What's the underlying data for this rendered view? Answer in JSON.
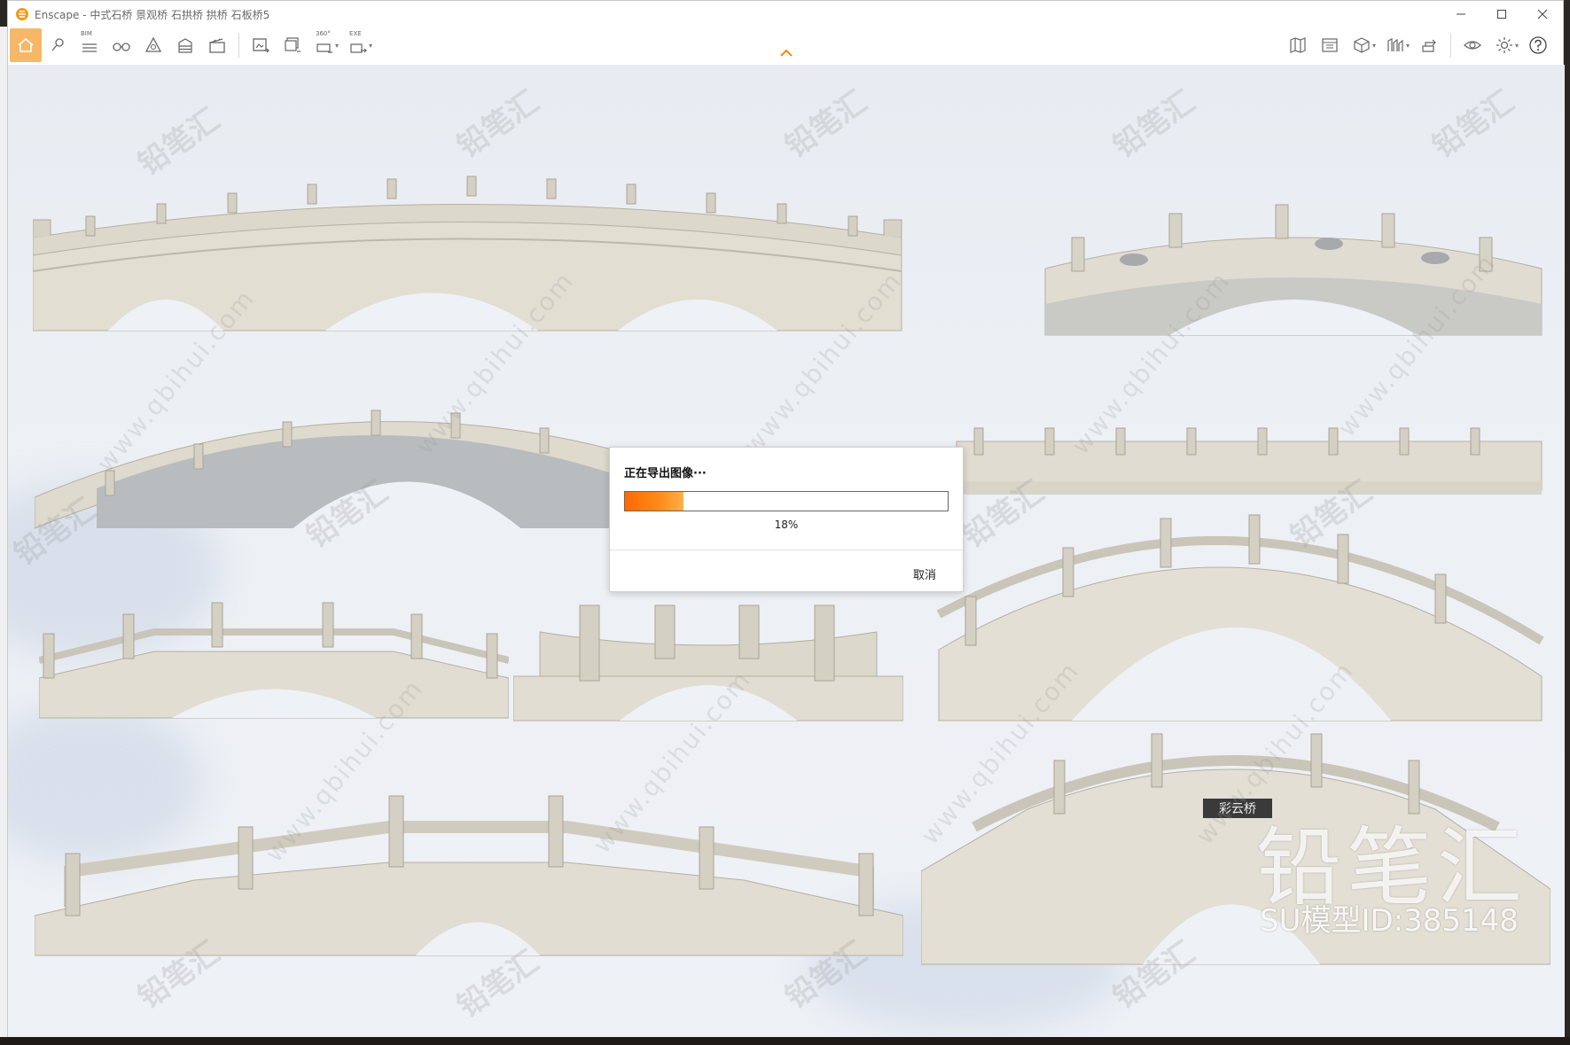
{
  "window": {
    "title": "Enscape - 中式石桥 景观桥 石拱桥 拱桥 石板桥5",
    "controls": [
      "—",
      "☐",
      "✕"
    ]
  },
  "toolbar": {
    "bim_label": "BIM",
    "pano_label": "360°",
    "exe_label": "EXE",
    "accent_color": "#f6b867"
  },
  "viewport": {
    "plaque_text": "彩云桥"
  },
  "watermark": {
    "brand": "铅笔汇",
    "model_id": "SU模型ID:385148",
    "url": "www.qbihui.com",
    "tile": "铅笔汇"
  },
  "export_dialog": {
    "title": "正在导出图像···",
    "progress_percent": 18,
    "progress_label": "18%",
    "cancel_label": "取消",
    "progress_color": "#ff7a10"
  }
}
